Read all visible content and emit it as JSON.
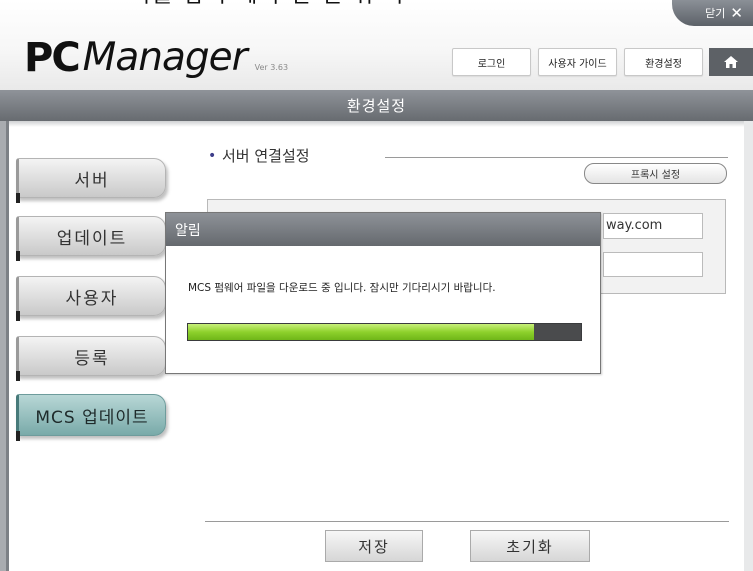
{
  "header": {
    "top_fragment": "치를 잡기 에서 현 된 뒤 마",
    "close_label": "닫기",
    "logo_pc": "PC",
    "logo_manager": "Manager",
    "version": "Ver 3.63",
    "buttons": {
      "login": "로그인",
      "guide": "사용자 가이드",
      "settings": "환경설정"
    },
    "home_icon": "home-icon",
    "close_icon": "close-icon"
  },
  "title_bar": {
    "title": "환경설정"
  },
  "nav": {
    "items": [
      {
        "label": "서버"
      },
      {
        "label": "업데이트"
      },
      {
        "label": "사용자"
      },
      {
        "label": "등록"
      },
      {
        "label": "MCS 업데이트",
        "active": true
      }
    ]
  },
  "main": {
    "section_title": "서버 연결설정",
    "proxy_button": "프록시 설정",
    "server_address_value": "way.com",
    "port_value": ""
  },
  "footer": {
    "save": "저장",
    "reset": "초기화"
  },
  "modal": {
    "title": "알림",
    "message": "MCS 펌웨어 파일을 다운로드 중 입니다. 잠시만 기다리시기 바랍니다.",
    "progress": 0.88
  },
  "colors": {
    "title_bar": "#76797e",
    "active_nav": "#9fc6c5",
    "progress_green": "#8ed12c",
    "progress_track": "#4a4b4d"
  }
}
